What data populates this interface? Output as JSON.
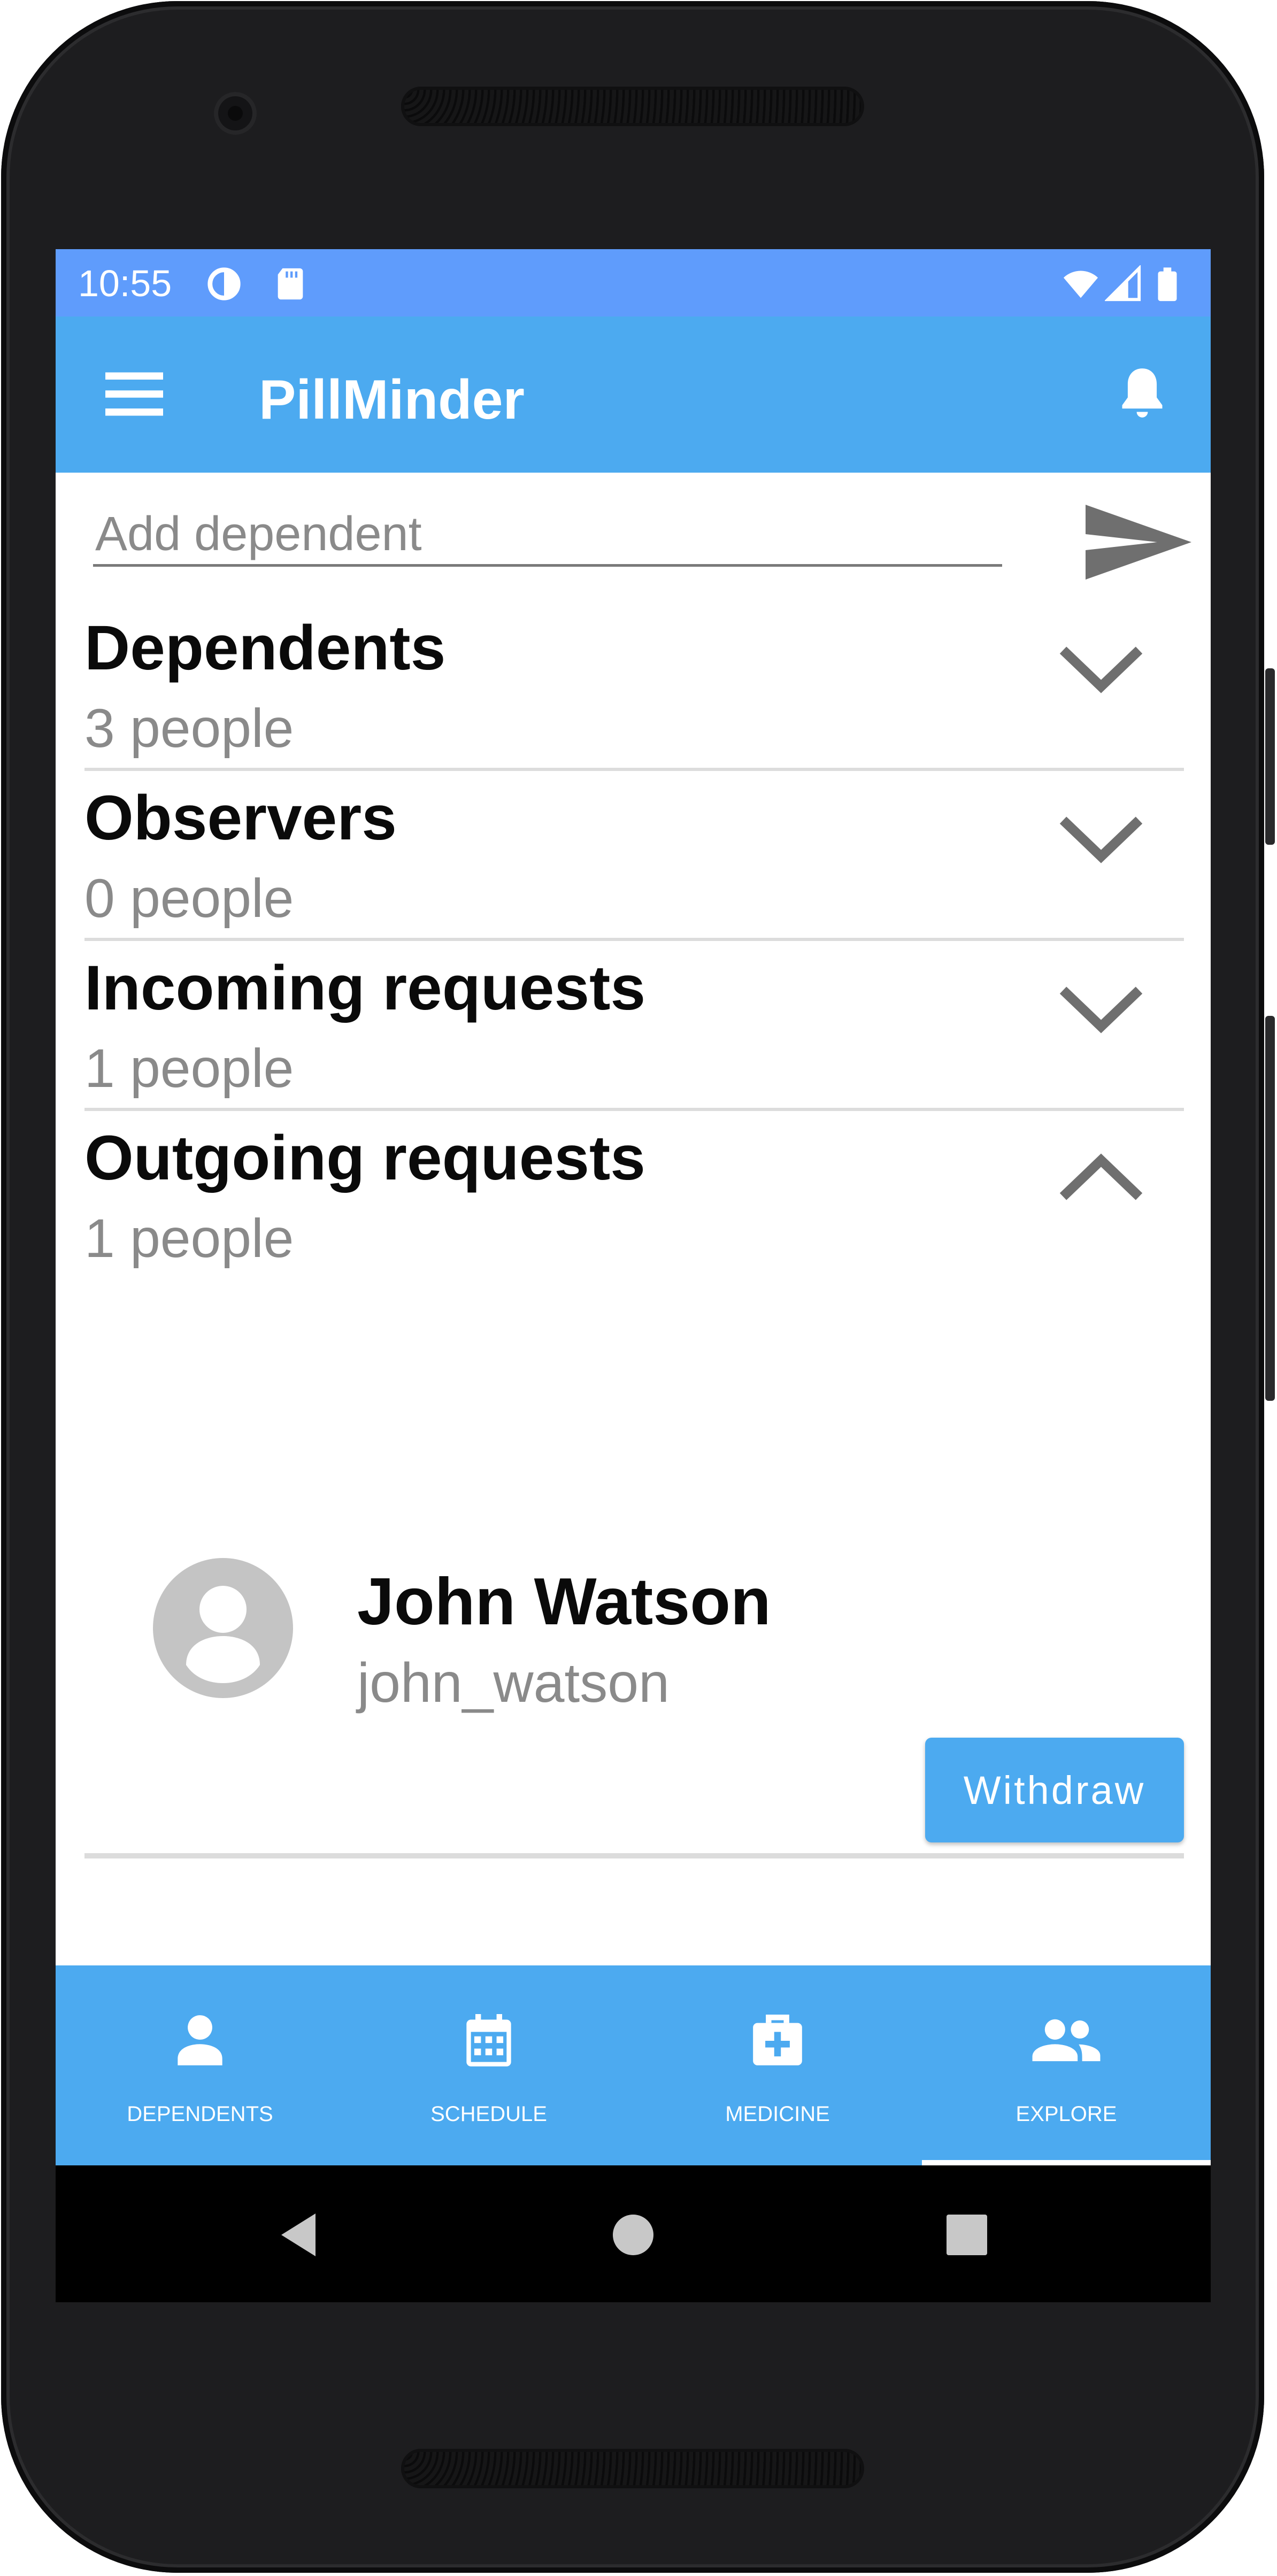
{
  "status_bar": {
    "time": "10:55",
    "icons": [
      "data-saver-icon",
      "sd-card-icon",
      "wifi-icon",
      "signal-icon",
      "battery-icon"
    ]
  },
  "app_bar": {
    "title": "PillMinder",
    "icons": [
      "menu-icon",
      "bell-icon"
    ]
  },
  "add_dependent": {
    "placeholder": "Add dependent",
    "value": "",
    "submit_icon": "send-icon"
  },
  "sections": [
    {
      "title": "Dependents",
      "count": "3 people",
      "expanded": false
    },
    {
      "title": "Observers",
      "count": "0 people",
      "expanded": false
    },
    {
      "title": "Incoming requests",
      "count": "1 people",
      "expanded": false
    },
    {
      "title": "Outgoing requests",
      "count": "1 people",
      "expanded": true
    }
  ],
  "outgoing_requests": [
    {
      "name": "John Watson",
      "username": "john_watson",
      "action_label": "Withdraw",
      "avatar_icon": "person-avatar-icon"
    }
  ],
  "bottom_nav": {
    "items": [
      {
        "label": "DEPENDENTS",
        "icon": "person-icon"
      },
      {
        "label": "SCHEDULE",
        "icon": "calendar-icon"
      },
      {
        "label": "MEDICINE",
        "icon": "medical-kit-icon"
      },
      {
        "label": "EXPLORE",
        "icon": "people-icon"
      }
    ],
    "selected": "EXPLORE"
  },
  "system_nav": {
    "icons": [
      "back-icon",
      "home-icon",
      "recents-icon"
    ]
  },
  "colors": {
    "status_bar": "#5f9cfc",
    "primary": "#4caaf0",
    "secondary_text": "#8a8a8a",
    "divider": "#dcdcdc",
    "device_frame": "#1d1d1f"
  }
}
